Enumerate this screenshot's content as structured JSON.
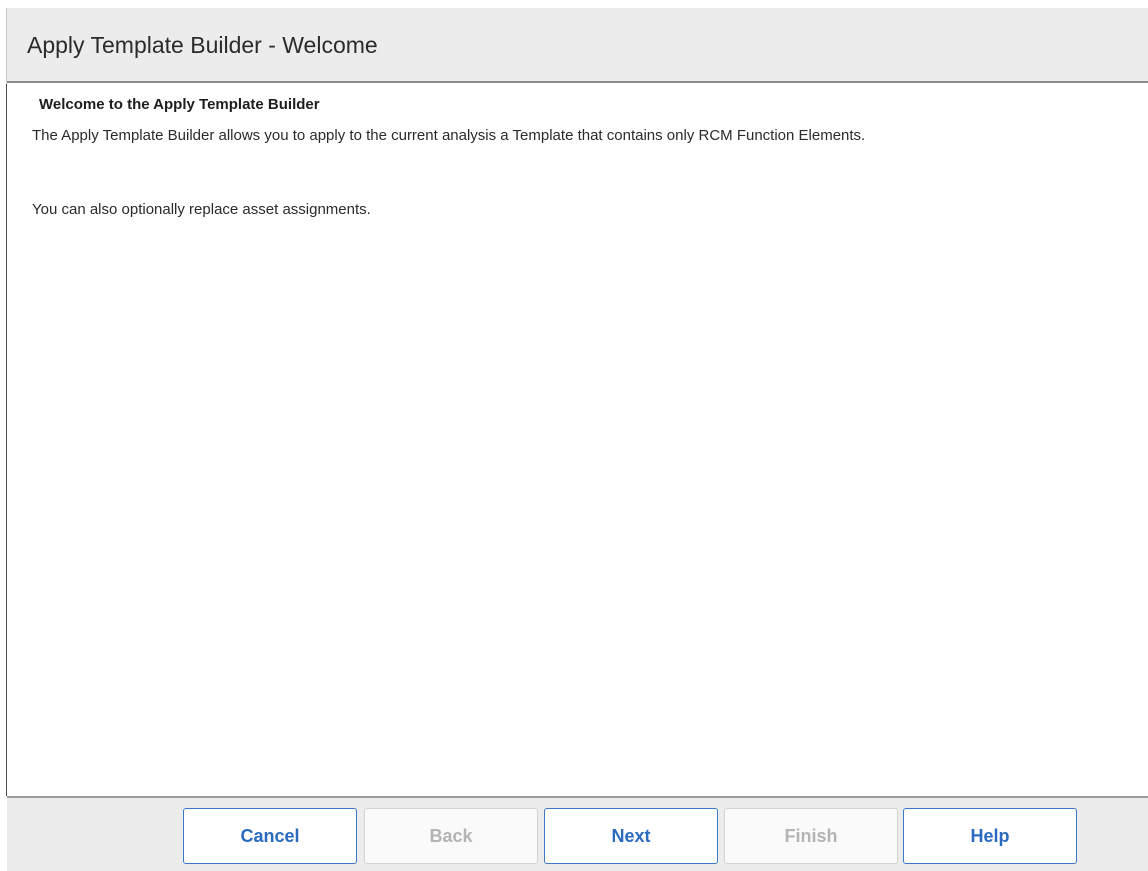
{
  "window": {
    "title": "Apply Template Builder - Welcome"
  },
  "content": {
    "heading": "Welcome to the Apply Template Builder",
    "description": "The Apply Template Builder allows you to apply to the current analysis a Template that contains only RCM Function Elements.",
    "note": "You can also optionally replace asset assignments."
  },
  "footer": {
    "buttons": {
      "cancel": {
        "label": "Cancel",
        "enabled": true
      },
      "back": {
        "label": "Back",
        "enabled": false
      },
      "next": {
        "label": "Next",
        "enabled": true
      },
      "finish": {
        "label": "Finish",
        "enabled": false
      },
      "help": {
        "label": "Help",
        "enabled": true
      }
    }
  },
  "colors": {
    "accent": "#2b6bbf",
    "disabled_text": "#b4b4b4",
    "header_background": "#ececec"
  }
}
